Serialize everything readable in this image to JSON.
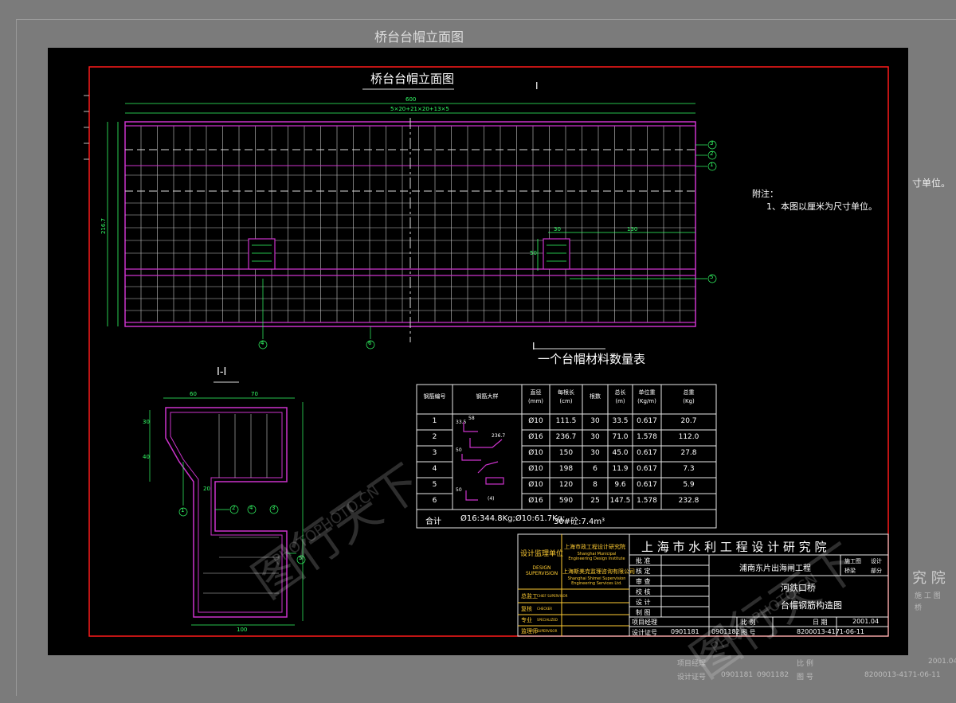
{
  "background": {
    "outer": "#7b7b7b",
    "sheet": "#000000",
    "frame": "#ff1a1a",
    "rebar": "#cc33cc",
    "grid": "#d0d0d0",
    "dim": "#33ff66",
    "cyan": "#33cccc"
  },
  "bg_title": "桥台台帽立面图",
  "bg_right_frag": "寸单位。",
  "bg_bottom": {
    "row1a": "项目经理",
    "row1b": "比 例",
    "row1c": "2001.04",
    "row2a": "设计证号",
    "row2b": "0901181",
    "row2c": "0901182",
    "row2d": "图 号",
    "row2e": "8200013-4171-06-11"
  },
  "bg_corner": {
    "institute": "究 院",
    "a": "施 工 图",
    "b": "设",
    "c": "桥",
    "d": "梁"
  },
  "elevation": {
    "title": "桥台台帽立面图",
    "section_mark": "I",
    "dim_total": "600",
    "dim_spacing": "5×20+21×20+13×5",
    "dim_height": "216.7",
    "dim_right_30": "30",
    "dim_right_130": "130",
    "dim_right_50": "50",
    "callouts": [
      "3",
      "2",
      "1",
      "5",
      "4",
      "6"
    ]
  },
  "notes": {
    "heading": "附注：",
    "line1": "1、本图以厘米为尺寸单位。"
  },
  "section": {
    "title": "I-I",
    "dim_60": "60",
    "dim_70": "70",
    "dim_30": "30",
    "dim_40": "40",
    "dim_20": "20",
    "dim_100": "100",
    "callouts": [
      "1",
      "2",
      "4",
      "3",
      "5"
    ]
  },
  "table": {
    "title": "一个台帽材料数量表",
    "headers": [
      "钢筋编号",
      "钢筋大样",
      "直径\n(mm)",
      "每根长\n(cm)",
      "根数",
      "总长\n(m)",
      "单位重\n(Kg/m)",
      "总重\n(Kg)"
    ],
    "rows": [
      [
        "1",
        "",
        "Ø10",
        "111.5",
        "30",
        "33.5",
        "0.617",
        "20.7"
      ],
      [
        "2",
        "",
        "Ø16",
        "236.7",
        "30",
        "71.0",
        "1.578",
        "112.0"
      ],
      [
        "3",
        "",
        "Ø10",
        "150",
        "30",
        "45.0",
        "0.617",
        "27.8"
      ],
      [
        "4",
        "",
        "Ø10",
        "198",
        "6",
        "11.9",
        "0.617",
        "7.3"
      ],
      [
        "5",
        "",
        "Ø10",
        "120",
        "8",
        "9.6",
        "0.617",
        "5.9"
      ],
      [
        "6",
        "",
        "Ø16",
        "590",
        "25",
        "147.5",
        "1.578",
        "232.8"
      ]
    ],
    "total_label": "合计",
    "total_value": "Ø16:344.8Kg;Ø10:61.7Kg;",
    "concrete": "30#砼:7.4m³",
    "sketch_labels": [
      "33.5",
      "58",
      "236.7",
      "50",
      "50",
      "(4)"
    ]
  },
  "titleblock": {
    "institute": "上 海 市 水 利 工 程 设 计 研 究 院",
    "supervision_cn": "设计监理单位",
    "supervision_en": "DESIGN SUPERVISION",
    "org1_cn": "上海市政工程设计研究院",
    "org1_en": "Shanghai Municipal Engineering Design Institute",
    "org2_cn": "上海斯美克监理咨询有限公司",
    "org2_en": "Shanghai Shimei Supervision Engineering Services Ltd.",
    "roles": [
      "批 准",
      "核 定",
      "审 查",
      "校 核",
      "设 计",
      "制 图"
    ],
    "review_labels": [
      "总监工",
      "复核",
      "专业",
      "监理师"
    ],
    "review_vals": [
      "CHIEF SUPERVISOR",
      "CHECKER",
      "SPECIALIZED",
      "SUPERVISOR"
    ],
    "project": "浦南东片出海闸工程",
    "stage_a": "施工图",
    "stage_b": "设计",
    "part_a": "桥梁",
    "part_b": "部分",
    "bridge": "河鉄口桥",
    "drawing": "台帽钢筋构造图",
    "pm": "项目经理",
    "scale_label": "比 例",
    "date_label": "日 期",
    "date": "2001.04",
    "cert_label": "设计证号",
    "cert1": "0901181",
    "cert2": "0901182",
    "drawno_label": "图 号",
    "drawno": "8200013-4171-06-11"
  },
  "watermark": {
    "cn": "图行天下",
    "en": "PHOTOPHOTO.CN"
  }
}
